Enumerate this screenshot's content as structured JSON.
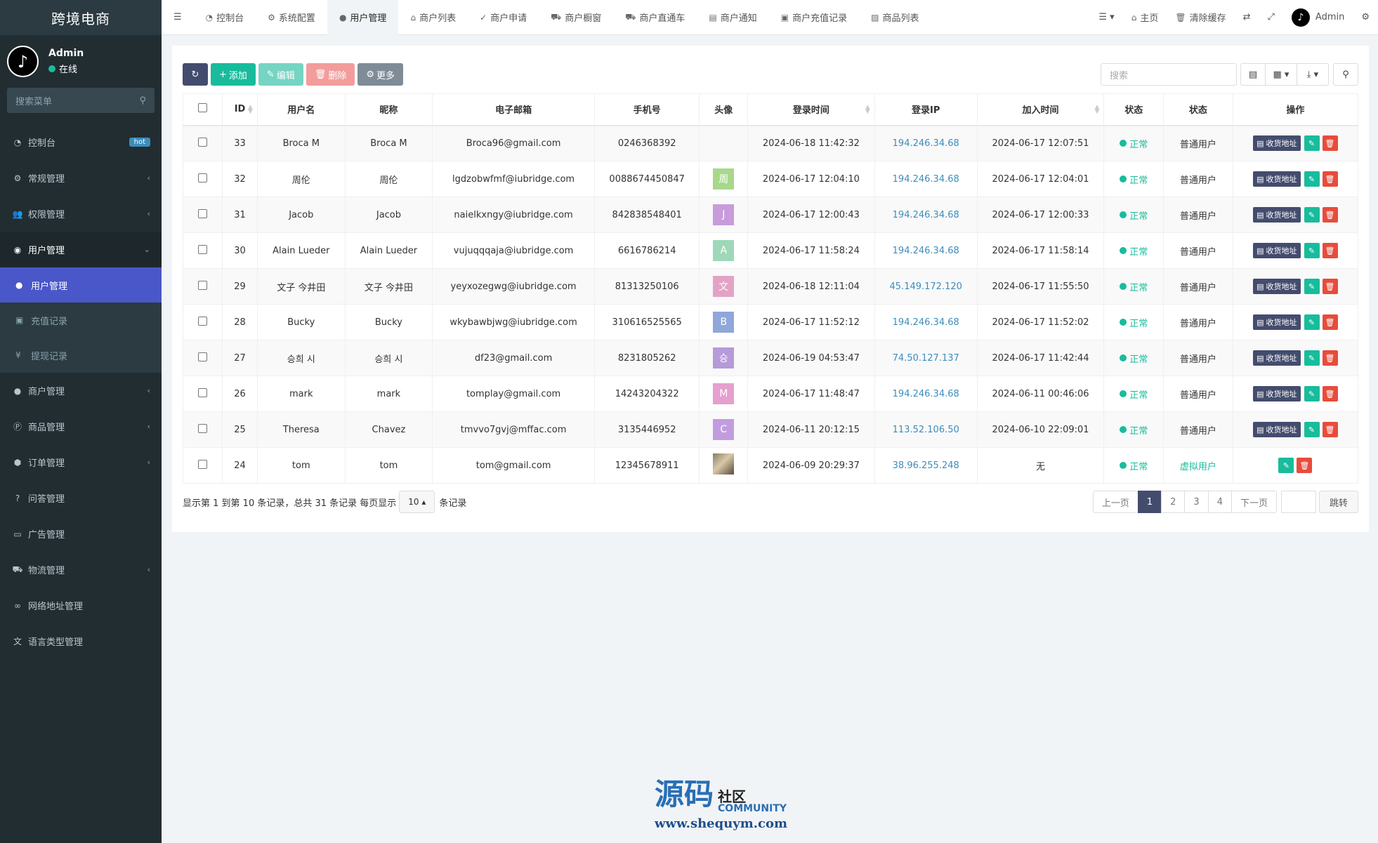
{
  "sidebar": {
    "brand": "跨境电商",
    "user_name": "Admin",
    "user_status": "在线",
    "search_placeholder": "搜索菜单",
    "items": [
      {
        "label": "控制台",
        "icon": "dashboard-icon",
        "badge": "hot"
      },
      {
        "label": "常规管理",
        "icon": "cogs-icon"
      },
      {
        "label": "权限管理",
        "icon": "group-icon"
      },
      {
        "label": "用户管理",
        "icon": "user-circle-icon"
      }
    ],
    "sub_items": [
      {
        "label": "用户管理",
        "icon": "user-icon"
      },
      {
        "label": "充值记录",
        "icon": "money-icon"
      },
      {
        "label": "提现记录",
        "icon": "yen-icon"
      }
    ],
    "items_after": [
      {
        "label": "商户管理",
        "icon": "apple-icon",
        "chevron": true
      },
      {
        "label": "商品管理",
        "icon": "product-icon",
        "chevron": true
      },
      {
        "label": "订单管理",
        "icon": "cube-icon",
        "chevron": true
      },
      {
        "label": "问答管理",
        "icon": "question-icon",
        "chevron": false
      },
      {
        "label": "广告管理",
        "icon": "ad-icon",
        "chevron": false
      },
      {
        "label": "物流管理",
        "icon": "truck-icon",
        "chevron": true
      },
      {
        "label": "网络地址管理",
        "icon": "link-icon",
        "chevron": false
      },
      {
        "label": "语言类型管理",
        "icon": "language-icon",
        "chevron": false
      }
    ]
  },
  "topbar": {
    "tabs": [
      "控制台",
      "系统配置",
      "用户管理",
      "商户列表",
      "商户申请",
      "商户橱窗",
      "商户直通车",
      "商户通知",
      "商户充值记录",
      "商品列表"
    ],
    "home": "主页",
    "clear_cache": "清除缓存",
    "admin": "Admin"
  },
  "toolbar": {
    "add": "添加",
    "edit": "编辑",
    "delete": "删除",
    "more": "更多",
    "search_placeholder": "搜索"
  },
  "table": {
    "headers": [
      "ID",
      "用户名",
      "昵称",
      "电子邮箱",
      "手机号",
      "头像",
      "登录时间",
      "登录IP",
      "加入时间",
      "状态",
      "状态",
      "操作"
    ],
    "address_btn": "收货地址",
    "rows": [
      {
        "id": "33",
        "username": "Broca M",
        "nickname": "Broca M",
        "email": "Broca96@gmail.com",
        "phone": "0246368392",
        "avatar": "",
        "avatar_color": "",
        "login_time": "2024-06-18 11:42:32",
        "ip": "194.246.34.68",
        "join_time": "2024-06-17 12:07:51",
        "status": "正常",
        "type": "普通用户"
      },
      {
        "id": "32",
        "username": "周伦",
        "nickname": "周伦",
        "email": "lgdzobwfmf@iubridge.com",
        "phone": "0088674450847",
        "avatar": "周",
        "avatar_color": "#a8d88a",
        "login_time": "2024-06-17 12:04:10",
        "ip": "194.246.34.68",
        "join_time": "2024-06-17 12:04:01",
        "status": "正常",
        "type": "普通用户"
      },
      {
        "id": "31",
        "username": "Jacob",
        "nickname": "Jacob",
        "email": "naielkxngy@iubridge.com",
        "phone": "842838548401",
        "avatar": "J",
        "avatar_color": "#c89bdc",
        "login_time": "2024-06-17 12:00:43",
        "ip": "194.246.34.68",
        "join_time": "2024-06-17 12:00:33",
        "status": "正常",
        "type": "普通用户"
      },
      {
        "id": "30",
        "username": "Alain Lueder",
        "nickname": "Alain Lueder",
        "email": "vujuqqqaja@iubridge.com",
        "phone": "6616786214",
        "avatar": "A",
        "avatar_color": "#9ed8b8",
        "login_time": "2024-06-17 11:58:24",
        "ip": "194.246.34.68",
        "join_time": "2024-06-17 11:58:14",
        "status": "正常",
        "type": "普通用户"
      },
      {
        "id": "29",
        "username": "文子 今井田",
        "nickname": "文子 今井田",
        "email": "yeyxozegwg@iubridge.com",
        "phone": "81313250106",
        "avatar": "文",
        "avatar_color": "#e3a3c6",
        "login_time": "2024-06-18 12:11:04",
        "ip": "45.149.172.120",
        "join_time": "2024-06-17 11:55:50",
        "status": "正常",
        "type": "普通用户"
      },
      {
        "id": "28",
        "username": "Bucky",
        "nickname": "Bucky",
        "email": "wkybawbjwg@iubridge.com",
        "phone": "310616525565",
        "avatar": "B",
        "avatar_color": "#8fa7d9",
        "login_time": "2024-06-17 11:52:12",
        "ip": "194.246.34.68",
        "join_time": "2024-06-17 11:52:02",
        "status": "正常",
        "type": "普通用户"
      },
      {
        "id": "27",
        "username": "승희 시",
        "nickname": "승희 시",
        "email": "df23@gmail.com",
        "phone": "8231805262",
        "avatar": "승",
        "avatar_color": "#b69ad9",
        "login_time": "2024-06-19 04:53:47",
        "ip": "74.50.127.137",
        "join_time": "2024-06-17 11:42:44",
        "status": "正常",
        "type": "普通用户"
      },
      {
        "id": "26",
        "username": "mark",
        "nickname": "mark",
        "email": "tomplay@gmail.com",
        "phone": "14243204322",
        "avatar": "M",
        "avatar_color": "#e5a0cf",
        "login_time": "2024-06-17 11:48:47",
        "ip": "194.246.34.68",
        "join_time": "2024-06-11 00:46:06",
        "status": "正常",
        "type": "普通用户"
      },
      {
        "id": "25",
        "username": "Theresa",
        "nickname": "Chavez",
        "email": "tmvvo7gvj@mffac.com",
        "phone": "3135446952",
        "avatar": "C",
        "avatar_color": "#c29ce0",
        "login_time": "2024-06-11 20:12:15",
        "ip": "113.52.106.50",
        "join_time": "2024-06-10 22:09:01",
        "status": "正常",
        "type": "普通用户"
      },
      {
        "id": "24",
        "username": "tom",
        "nickname": "tom",
        "email": "tom@gmail.com",
        "phone": "12345678911",
        "avatar": "",
        "avatar_color": "photo",
        "login_time": "2024-06-09 20:29:37",
        "ip": "38.96.255.248",
        "join_time": "无",
        "status": "正常",
        "type": "虚拟用户"
      }
    ]
  },
  "footer": {
    "info_prefix": "显示第 1 到第 10 条记录，总共 31 条记录 每页显示",
    "page_size": "10",
    "info_suffix": "条记录",
    "prev": "上一页",
    "pages": [
      "1",
      "2",
      "3",
      "4"
    ],
    "next": "下一页",
    "go": "跳转"
  },
  "watermark": {
    "big": "源码",
    "side_a": "社区",
    "side_b": "COMMUNITY",
    "url": "www.shequym.com"
  }
}
